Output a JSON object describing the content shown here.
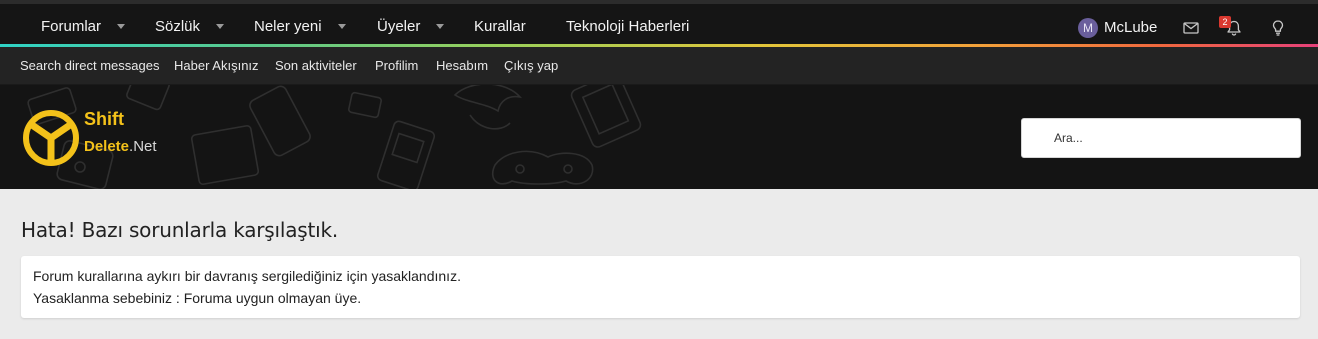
{
  "top_nav": {
    "items": [
      {
        "label": "Forumlar",
        "has_dropdown": true
      },
      {
        "label": "Sözlük",
        "has_dropdown": true
      },
      {
        "label": "Neler yeni",
        "has_dropdown": true
      },
      {
        "label": "Üyeler",
        "has_dropdown": true
      },
      {
        "label": "Kurallar",
        "has_dropdown": false
      },
      {
        "label": "Teknoloji Haberleri",
        "has_dropdown": false
      }
    ],
    "user": {
      "avatar_letter": "M",
      "name": "McLube"
    },
    "alerts_badge": "2",
    "icons": [
      "envelope-icon",
      "bell-icon",
      "lightbulb-icon"
    ]
  },
  "sub_nav": {
    "links": [
      "Search direct messages",
      "Haber Akışınız",
      "Son aktiviteler",
      "Profilim",
      "Hesabım",
      "Çıkış yap"
    ]
  },
  "header": {
    "logo_line1": "Shift",
    "logo_line2": "Delete",
    "logo_net": ".Net",
    "search_placeholder": "Ara..."
  },
  "error": {
    "title": "Hata! Bazı sorunlarla karşılaştık.",
    "line1": "Forum kurallarına aykırı bir davranış sergilediğiniz için yasaklandınız.",
    "line2": "Yasaklanma sebebiniz : Foruma uygun olmayan üye."
  },
  "colors": {
    "nav_bg": "#151515",
    "accent_yellow": "#f4c21a",
    "page_bg": "#ebebeb",
    "badge_red": "#d9382f"
  }
}
